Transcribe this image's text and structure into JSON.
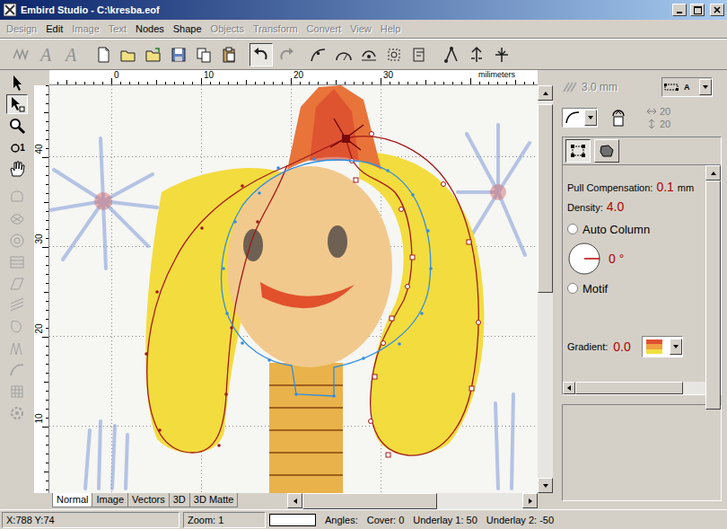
{
  "window": {
    "title": "Embird Studio - C:\\kresba.eof"
  },
  "menu": [
    {
      "label": "Design",
      "disabled": true
    },
    {
      "label": "Edit",
      "disabled": false
    },
    {
      "label": "Image",
      "disabled": true
    },
    {
      "label": "Text",
      "disabled": true
    },
    {
      "label": "Nodes",
      "disabled": false
    },
    {
      "label": "Shape",
      "disabled": false
    },
    {
      "label": "Objects",
      "disabled": true
    },
    {
      "label": "Transform",
      "disabled": true
    },
    {
      "label": "Convert",
      "disabled": true
    },
    {
      "label": "View",
      "disabled": true
    },
    {
      "label": "Help",
      "disabled": true
    }
  ],
  "toolbar": [
    {
      "disabled": true,
      "selected": false
    },
    {
      "glyph": "A",
      "disabled": true,
      "selected": false
    },
    {
      "glyph": "A",
      "disabled": true,
      "selected": false
    },
    {
      "disabled": false,
      "selected": false
    },
    {
      "disabled": false,
      "selected": false
    },
    {
      "disabled": false,
      "selected": false
    },
    {
      "disabled": false,
      "selected": false
    },
    {
      "disabled": false,
      "selected": false
    },
    {
      "disabled": false,
      "selected": false
    },
    {
      "disabled": false,
      "selected": true
    },
    {
      "disabled": true,
      "selected": false
    },
    {
      "disabled": false,
      "selected": false
    },
    {
      "disabled": false,
      "selected": false
    },
    {
      "disabled": false,
      "selected": false
    },
    {
      "disabled": false,
      "selected": false
    },
    {
      "disabled": false,
      "selected": false
    },
    {
      "disabled": false,
      "selected": false
    },
    {
      "disabled": false,
      "selected": false
    },
    {
      "disabled": false,
      "selected": false
    }
  ],
  "tools": [
    {
      "disabled": false,
      "selected": false
    },
    {
      "disabled": false,
      "selected": true
    },
    {
      "disabled": false,
      "selected": false
    },
    {
      "glyph": "1",
      "disabled": false,
      "selected": false
    },
    {
      "disabled": false,
      "selected": false
    },
    {
      "disabled": true,
      "selected": false
    },
    {
      "disabled": true,
      "selected": false
    },
    {
      "disabled": true,
      "selected": false
    },
    {
      "disabled": true,
      "selected": false
    },
    {
      "disabled": true,
      "selected": false
    },
    {
      "disabled": true,
      "selected": false
    },
    {
      "disabled": true,
      "selected": false
    },
    {
      "disabled": true,
      "selected": false
    },
    {
      "disabled": true,
      "selected": false
    },
    {
      "disabled": true,
      "selected": false
    },
    {
      "disabled": true,
      "selected": false
    }
  ],
  "ruler": {
    "unit": "milimeters",
    "top": [
      "0",
      "10",
      "20",
      "30"
    ],
    "left": [
      "40",
      "30",
      "20",
      "10"
    ]
  },
  "view_tabs": [
    {
      "label": "Normal",
      "selected": true
    },
    {
      "label": "Image",
      "selected": false
    },
    {
      "label": "Vectors",
      "selected": false
    },
    {
      "label": "3D",
      "selected": false
    },
    {
      "label": "3D Matte",
      "selected": false
    }
  ],
  "panel": {
    "stitch_length": {
      "text": "3.0 mm",
      "disabled": true
    },
    "stitch_type_glyph": "A",
    "counts": [
      "20",
      "20"
    ],
    "panel_tabs": [
      {
        "selected": true
      },
      {
        "selected": false
      }
    ],
    "pull": {
      "label": "Pull Compensation:",
      "value": "0.1",
      "unit": "mm"
    },
    "density": {
      "label": "Density:",
      "value": "4.0"
    },
    "options": [
      {
        "label": "Auto Column",
        "selected": false
      },
      {
        "label": "Motif",
        "selected": false
      }
    ],
    "angle": "0 °",
    "gradient": {
      "label": "Gradient:",
      "value": "0.0"
    }
  },
  "status_bar": {
    "coords": "X:788 Y:74",
    "zoom": "Zoom: 1",
    "angles": "Angles:",
    "cover": "Cover: 0",
    "underlay1": "Underlay 1: 50",
    "underlay2": "Underlay 2: -50"
  }
}
